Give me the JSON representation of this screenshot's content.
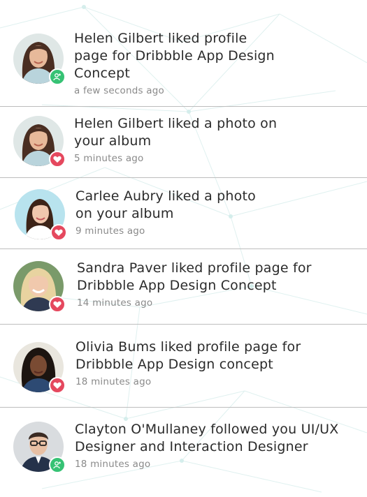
{
  "colors": {
    "badge_like": "#e5485e",
    "badge_follow": "#36c274",
    "text": "#2b2b2b",
    "muted": "#8a8a8a",
    "divider": "#bdbdbd"
  },
  "notifications": [
    {
      "message_line1": "Helen Gilbert liked profile",
      "message_line2": "page for Dribbble App Design",
      "message_line3": "Concept",
      "time": "a few seconds ago",
      "badge_icon": "add-user-icon"
    },
    {
      "message_line1": "Helen Gilbert liked a photo on",
      "message_line2": "your album",
      "time": "5 minutes ago",
      "badge_icon": "heart-icon"
    },
    {
      "message_line1": "Carlee Aubry liked a photo",
      "message_line2": "on your album",
      "time": "9 minutes ago",
      "badge_icon": "heart-icon"
    },
    {
      "message_line1": "Sandra Paver liked profile page for",
      "message_line2": "Dribbble App Design Concept",
      "time": "14 minutes ago",
      "badge_icon": "heart-icon"
    },
    {
      "message_line1": "Olivia Bums liked profile page for",
      "message_line2": "Dribbble App Design concept",
      "time": "18 minutes ago",
      "badge_icon": "heart-icon"
    },
    {
      "message_line1": "Clayton O'Mullaney followed you UI/UX",
      "message_line2": "Designer and Interaction Designer",
      "time": "18 minutes ago",
      "badge_icon": "add-user-icon"
    }
  ]
}
